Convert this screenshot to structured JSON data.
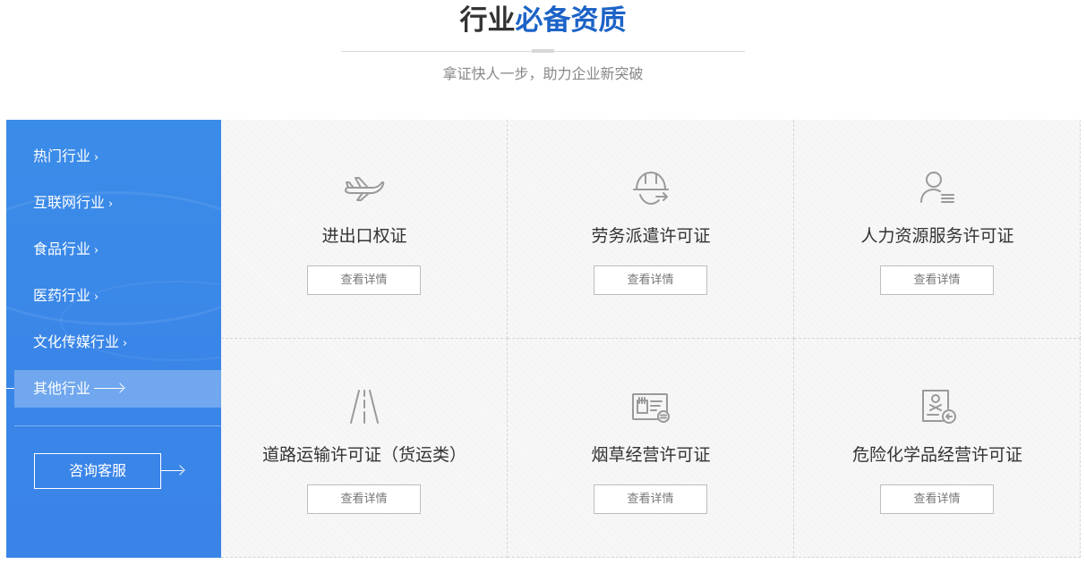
{
  "header": {
    "title_main": "行业",
    "title_highlight": "必备资质",
    "subtitle": "拿证快人一步，助力企业新突破"
  },
  "sidebar": {
    "items": [
      {
        "label": "热门行业",
        "chevron": "›",
        "active": false
      },
      {
        "label": "互联网行业",
        "chevron": "›",
        "active": false
      },
      {
        "label": "食品行业",
        "chevron": "›",
        "active": false
      },
      {
        "label": "医药行业",
        "chevron": "›",
        "active": false
      },
      {
        "label": "文化传媒行业",
        "chevron": "›",
        "active": false
      },
      {
        "label": "其他行业",
        "chevron": "",
        "active": true
      }
    ],
    "consult_label": "咨询客服"
  },
  "cards": [
    {
      "name": "进出口权证",
      "button": "查看详情",
      "icon": "airplane-icon"
    },
    {
      "name": "劳务派遣许可证",
      "button": "查看详情",
      "icon": "helmet-icon"
    },
    {
      "name": "人力资源服务许可证",
      "button": "查看详情",
      "icon": "person-list-icon"
    },
    {
      "name": "道路运输许可证（货运类）",
      "button": "查看详情",
      "icon": "road-icon"
    },
    {
      "name": "烟草经营许可证",
      "button": "查看详情",
      "icon": "license-card-icon"
    },
    {
      "name": "危险化学品经营许可证",
      "button": "查看详情",
      "icon": "hazard-document-icon"
    }
  ],
  "colors": {
    "accent": "#1d63c7",
    "panel": "#3a86e8",
    "icon": "#9a9a9a"
  }
}
